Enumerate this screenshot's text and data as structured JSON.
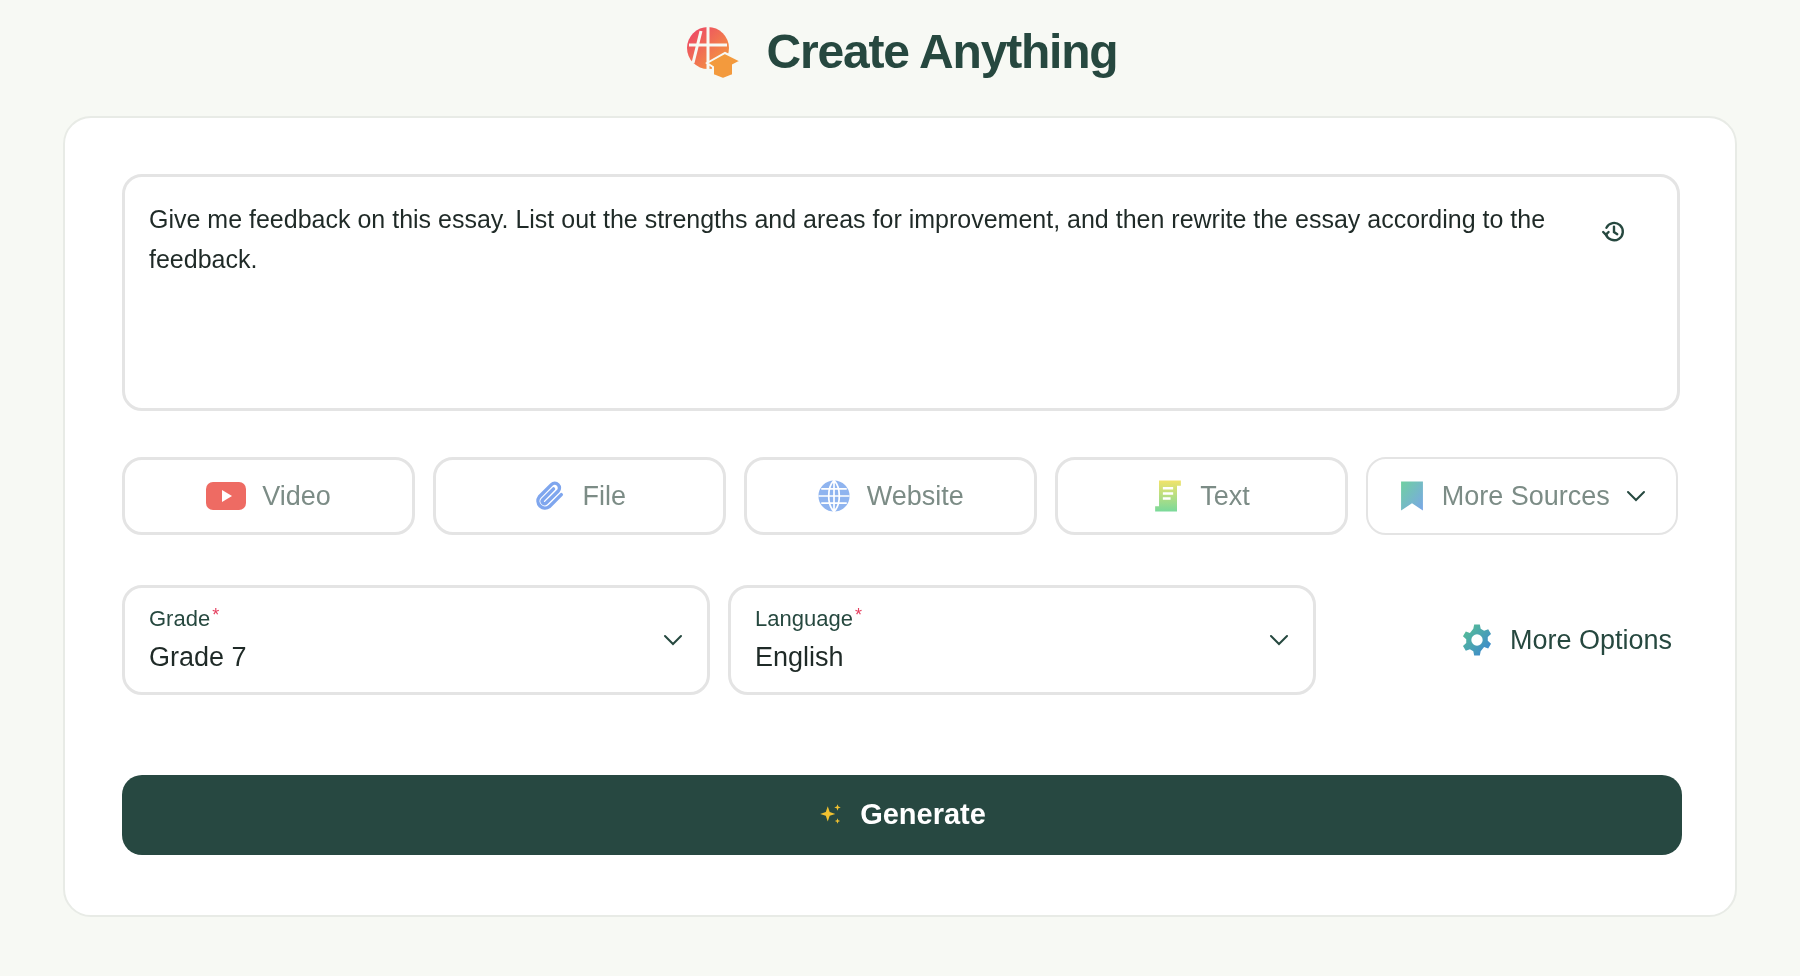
{
  "header": {
    "title": "Create Anything"
  },
  "prompt": {
    "value": "Give me feedback on this essay. List out the strengths and areas for improvement, and then rewrite the essay according to the feedback."
  },
  "sources": [
    {
      "kind": "video",
      "label": "Video"
    },
    {
      "kind": "file",
      "label": "File"
    },
    {
      "kind": "website",
      "label": "Website"
    },
    {
      "kind": "text",
      "label": "Text"
    },
    {
      "kind": "more",
      "label": "More Sources"
    }
  ],
  "selects": [
    {
      "label": "Grade",
      "required_mark": "*",
      "value": "Grade 7"
    },
    {
      "label": "Language",
      "required_mark": "*",
      "value": "English"
    }
  ],
  "more_options": {
    "label": "More Options"
  },
  "generate": {
    "label": "Generate"
  }
}
